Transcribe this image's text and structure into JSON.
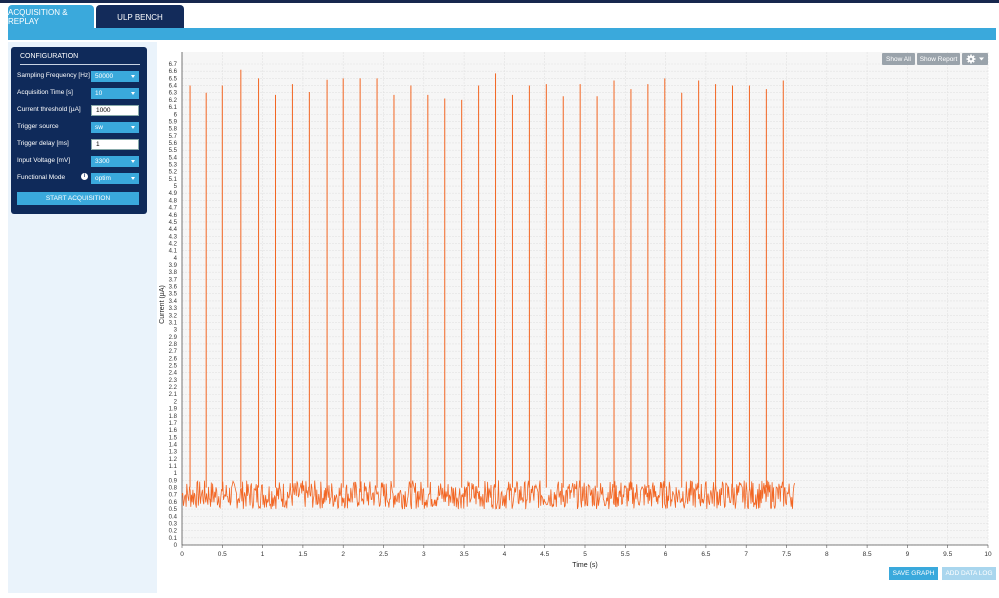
{
  "tabs": [
    {
      "label": "ACQUISITION & REPLAY"
    },
    {
      "label": "ULP BENCH"
    }
  ],
  "config": {
    "title": "CONFIGURATION",
    "fields": [
      {
        "label": "Sampling Frequency [Hz]",
        "value": "50000",
        "kind": "select"
      },
      {
        "label": "Acquisition Time [s]",
        "value": "10",
        "kind": "select"
      },
      {
        "label": "Current threshold [µA]",
        "value": "1000",
        "kind": "input"
      },
      {
        "label": "Trigger source",
        "value": "sw",
        "kind": "select"
      },
      {
        "label": "Trigger delay [ms]",
        "value": "1",
        "kind": "input"
      },
      {
        "label": "Input Voltage [mV]",
        "value": "3300",
        "kind": "select"
      },
      {
        "label": "Functional Mode",
        "value": "optim",
        "kind": "select"
      }
    ],
    "start_label": "START ACQUISITION"
  },
  "toolbar": {
    "show_all": "Show All",
    "show_report": "Show Report",
    "gear": "gear-icon"
  },
  "buttons": {
    "save_graph": "SAVE GRAPH",
    "add_data_log": "ADD DATA LOG"
  },
  "colors": {
    "accent": "#3aa9dc",
    "navy": "#0f2a5a",
    "trace": "#f26522"
  },
  "chart_data": {
    "type": "line",
    "xlabel": "Time (s)",
    "ylabel": "Current (µA)",
    "xlim": [
      0,
      10
    ],
    "ylim": [
      0,
      6.7
    ],
    "x_ticks": [
      0,
      0.5,
      1,
      1.5,
      2,
      2.5,
      3,
      3.5,
      4,
      4.5,
      5,
      5.5,
      6,
      6.5,
      7,
      7.5,
      8,
      8.5,
      9,
      9.5,
      10
    ],
    "x_tick_labels": [
      "0",
      "0.5",
      "1",
      "1.5",
      "2",
      "2.5",
      "3",
      "3.5",
      "4",
      "4.5",
      "5",
      "5.5",
      "6",
      "6.5",
      "7",
      "7.5",
      "8",
      "8.5",
      "9",
      "9.5",
      "10"
    ],
    "y_tick_step": 0.1,
    "grid": true,
    "baseline": {
      "x_start": 0,
      "x_end": 7.6,
      "y_min": 0.5,
      "y_max": 0.9
    },
    "spikes": [
      {
        "x": 0.1,
        "y": 6.4
      },
      {
        "x": 0.3,
        "y": 6.3
      },
      {
        "x": 0.5,
        "y": 6.4
      },
      {
        "x": 0.73,
        "y": 6.62
      },
      {
        "x": 0.95,
        "y": 6.5
      },
      {
        "x": 1.16,
        "y": 6.27
      },
      {
        "x": 1.37,
        "y": 6.42
      },
      {
        "x": 1.58,
        "y": 6.31
      },
      {
        "x": 1.8,
        "y": 6.48
      },
      {
        "x": 2.0,
        "y": 6.5
      },
      {
        "x": 2.21,
        "y": 6.5
      },
      {
        "x": 2.42,
        "y": 6.5
      },
      {
        "x": 2.63,
        "y": 6.27
      },
      {
        "x": 2.84,
        "y": 6.4
      },
      {
        "x": 3.05,
        "y": 6.27
      },
      {
        "x": 3.26,
        "y": 6.22
      },
      {
        "x": 3.47,
        "y": 6.2
      },
      {
        "x": 3.68,
        "y": 6.4
      },
      {
        "x": 3.89,
        "y": 6.57
      },
      {
        "x": 4.1,
        "y": 6.27
      },
      {
        "x": 4.31,
        "y": 6.4
      },
      {
        "x": 4.52,
        "y": 6.42
      },
      {
        "x": 4.73,
        "y": 6.25
      },
      {
        "x": 4.94,
        "y": 6.42
      },
      {
        "x": 5.15,
        "y": 6.25
      },
      {
        "x": 5.36,
        "y": 6.47
      },
      {
        "x": 5.57,
        "y": 6.35
      },
      {
        "x": 5.78,
        "y": 6.42
      },
      {
        "x": 5.99,
        "y": 6.5
      },
      {
        "x": 6.2,
        "y": 6.3
      },
      {
        "x": 6.41,
        "y": 6.47
      },
      {
        "x": 6.62,
        "y": 6.42
      },
      {
        "x": 6.83,
        "y": 6.4
      },
      {
        "x": 7.04,
        "y": 6.4
      },
      {
        "x": 7.25,
        "y": 6.35
      },
      {
        "x": 7.46,
        "y": 6.47
      }
    ]
  }
}
